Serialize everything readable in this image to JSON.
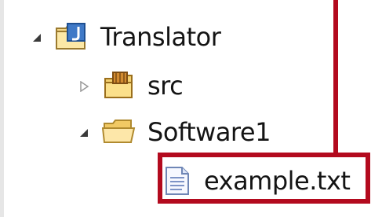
{
  "tree": {
    "project": {
      "label": "Translator",
      "expanded": true,
      "icon": "java-project-folder-icon"
    },
    "items": [
      {
        "label": "src",
        "expanded": false,
        "icon": "source-package-folder-icon"
      },
      {
        "label": "Software1",
        "expanded": true,
        "icon": "folder-icon"
      }
    ],
    "file": {
      "label": "example.txt",
      "icon": "text-file-icon"
    }
  },
  "annotation": {
    "color": "#b30a1e",
    "highlighted": "example.txt"
  }
}
